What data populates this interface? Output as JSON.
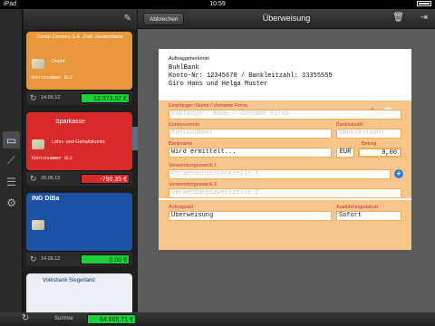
{
  "status": {
    "device": "iPad",
    "time": "10:59"
  },
  "accounts": [
    {
      "bank": "Cortal Consors S.A. Zndl. Deutschland",
      "desc": "Depot",
      "num": "Kontonummer    BLZ",
      "date": "14.06.12",
      "balance": "12.073,57 €",
      "kind": "pos",
      "color": "#e8973b"
    },
    {
      "bank": "Sparkasse",
      "desc": "Lohn- und Gehaltskonto",
      "num": "Kontonummer    BLZ",
      "date": "20.06.12",
      "balance": "-799,35 €",
      "kind": "neg",
      "color": "#d92a2a"
    },
    {
      "bank": "ING DiBa",
      "desc": "",
      "num": "",
      "date": "14.06.12",
      "balance": "0,00 €",
      "kind": "pos",
      "color": "#1b52a8"
    },
    {
      "bank": "Volksbank Siegerland",
      "desc": "",
      "num": "",
      "date": "",
      "balance": "",
      "kind": "pos",
      "color": "#2d72c4"
    }
  ],
  "toolbar": {
    "cancel_label": "Abbrechen",
    "title": "Überweisung"
  },
  "form": {
    "source_label": "Auftraggeberkonto",
    "source_text": "BuhlBank\nKonto-Nr: 12345678 / Bankleitzahl: 33355555\nGiro Hans und Helga Muster",
    "recipient_label": "Empfänger: Name / Vorname Firma",
    "recipient_placeholder": "Empfänger: Name / Vorname Firma",
    "account_label": "Kontonummer",
    "account_placeholder": "Kontonummer",
    "blz_label": "Bankleitzahl",
    "blz_placeholder": "Bankleitzahl",
    "bank_label": "Bankname",
    "bank_value": "Wird ermittelt...",
    "currency": "EUR",
    "amount_label": "Betrag",
    "amount_value": "0,00",
    "purpose1_label": "Verwendungszweck 1",
    "purpose1_placeholder": "Verwendungszweckzeile 1",
    "purpose2_label": "Verwendungszweck 2",
    "purpose2_placeholder": "Verwendungszweckzeile 2",
    "order_label": "Auftragsart",
    "order_value": "Überweisung",
    "exec_label": "Ausführungsdatum",
    "exec_value": "Sofort"
  },
  "footer": {
    "sum_label": "Summe",
    "sum_value": "64.665,71 €"
  }
}
